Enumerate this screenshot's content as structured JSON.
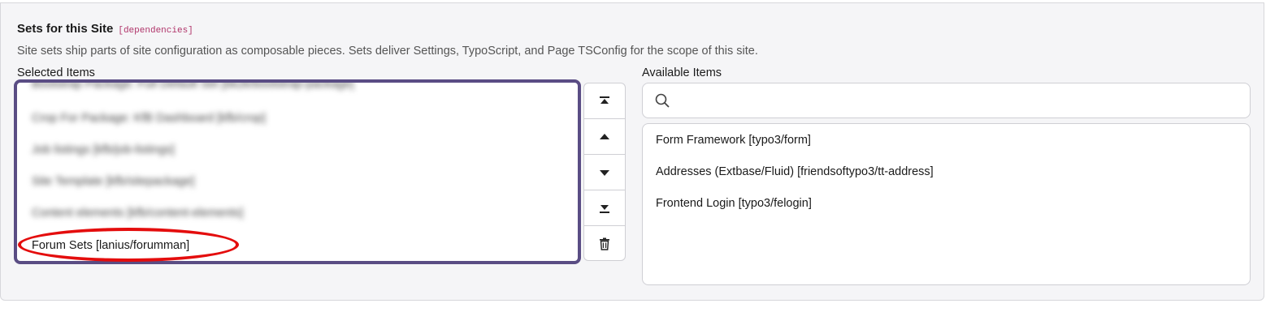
{
  "section": {
    "title": "Sets for this Site",
    "code_tag": "[dependencies]",
    "description": "Site sets ship parts of site configuration as composable pieces. Sets deliver Settings, TypoScript, and Page TSConfig for the scope of this site."
  },
  "selected": {
    "label": "Selected Items",
    "items": [
      "Bootstrap Package: Full Default Set [bk2k/bootstrap-package]",
      "Crop For Package: KfB Dashboard [kfb/crop]",
      "Job listings [kfb/job-listings]",
      "Site Template [kfb/sitepackage]",
      "Content elements [kfb/content-elements]",
      "Forum Sets [lanius/forumman]"
    ]
  },
  "buttons": {
    "move_top": "move-to-top-icon",
    "move_up": "move-up-icon",
    "move_down": "move-down-icon",
    "move_bottom": "move-to-bottom-icon",
    "remove": "trash-icon"
  },
  "available": {
    "label": "Available Items",
    "search_placeholder": "",
    "items": [
      "Form Framework [typo3/form]",
      "Addresses (Extbase/Fluid) [friendsoftypo3/tt-address]",
      "Frontend Login [typo3/felogin]"
    ]
  },
  "colors": {
    "selected_border": "#5a4d84",
    "highlight": "#e40d0d",
    "code_tag": "#b0346a"
  }
}
